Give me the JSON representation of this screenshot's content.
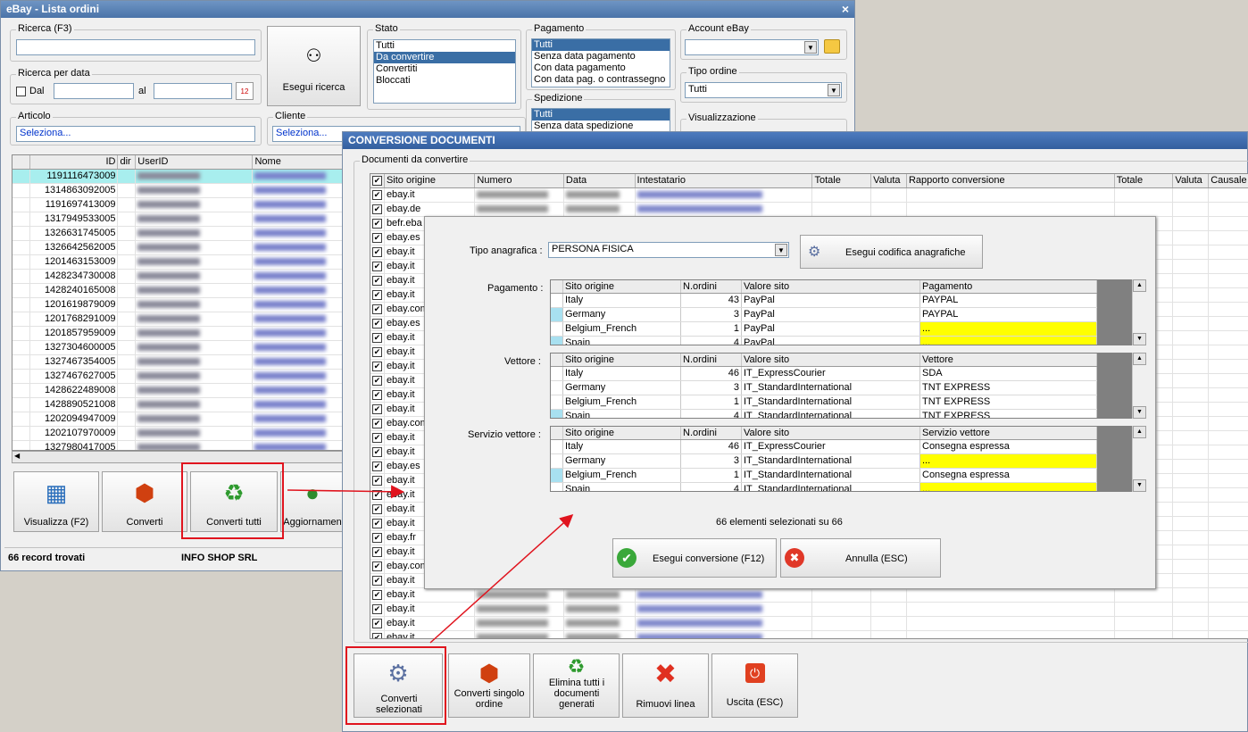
{
  "main_window": {
    "title": "eBay - Lista ordini",
    "close": "×",
    "ricerca_label": "Ricerca (F3)",
    "ricerca_value": "",
    "ricerca_data_label": "Ricerca per data",
    "dal_label": "Dal",
    "al_label": "al",
    "calendar_text": "12",
    "esegui_ricerca": "Esegui ricerca",
    "articolo_label": "Articolo",
    "articolo_value": "Seleziona...",
    "cliente_label": "Cliente",
    "cliente_value": "Seleziona...",
    "stato_label": "Stato",
    "stato_items": [
      "Tutti",
      "Da convertire",
      "Convertiti",
      "Bloccati"
    ],
    "pagamento_label": "Pagamento",
    "pagamento_items": [
      "Tutti",
      "Senza data pagamento",
      "Con data pagamento",
      "Con data pag. o contrassegno"
    ],
    "spedizione_label": "Spedizione",
    "spedizione_items": [
      "Tutti",
      "Senza data spedizione"
    ],
    "account_label": "Account eBay",
    "account_value": "",
    "tipo_ordine_label": "Tipo ordine",
    "tipo_ordine_value": "Tutti",
    "visualizzazione_label": "Visualizzazione",
    "grid_headers": [
      "ID",
      "dir",
      "UserID",
      "Nome"
    ],
    "grid_ids": [
      "1191116473009",
      "1314863092005",
      "1191697413009",
      "1317949533005",
      "1326631745005",
      "1326642562005",
      "1201463153009",
      "1428234730008",
      "1428240165008",
      "1201619879009",
      "1201768291009",
      "1201857959009",
      "1327304600005",
      "1327467354005",
      "1327467627005",
      "1428622489008",
      "1428890521008",
      "1202094947009",
      "1202107970009",
      "1327980417005"
    ],
    "btn_visualizza": "Visualizza (F2)",
    "btn_converti": "Converti",
    "btn_converti_tutti": "Converti tutti",
    "btn_aggiornamenti": "Aggiornamen",
    "status_records": "66 record trovati",
    "status_company": "INFO SHOP SRL"
  },
  "conv_window": {
    "title": "CONVERSIONE DOCUMENTI",
    "group_label": "Documenti da convertire",
    "headers": [
      "Sito origine",
      "Numero",
      "Data",
      "Intestatario",
      "Totale",
      "Valuta",
      "Rapporto conversione",
      "Totale",
      "Valuta",
      "Causale"
    ],
    "sites": [
      "ebay.it",
      "ebay.de",
      "befr.eba",
      "ebay.es",
      "ebay.it",
      "ebay.it",
      "ebay.it",
      "ebay.it",
      "ebay.com",
      "ebay.es",
      "ebay.it",
      "ebay.it",
      "ebay.it",
      "ebay.it",
      "ebay.it",
      "ebay.it",
      "ebay.com",
      "ebay.it",
      "ebay.it",
      "ebay.es",
      "ebay.it",
      "ebay.it",
      "ebay.it",
      "ebay.it",
      "ebay.fr",
      "ebay.it",
      "ebay.com",
      "ebay.it",
      "ebay.it",
      "ebay.it",
      "ebay.it",
      "ebay.it"
    ],
    "btn_converti_selezionati": "Converti selezionati",
    "btn_converti_singolo": "Converti singolo ordine",
    "btn_elimina": "Elimina tutti i documenti generati",
    "btn_rimuovi": "Rimuovi linea",
    "btn_uscita": "Uscita (ESC)"
  },
  "dialog": {
    "tipo_anagrafica_label": "Tipo anagrafica :",
    "tipo_anagrafica_value": "PERSONA FISICA",
    "btn_codifica": "Esegui codifica anagrafiche",
    "pagamento_label": "Pagamento :",
    "vettore_label": "Vettore :",
    "servizio_label": "Servizio vettore :",
    "col_sito": "Sito origine",
    "col_nordini": "N.ordini",
    "col_valore": "Valore sito",
    "col_pagamento": "Pagamento",
    "col_vettore": "Vettore",
    "col_servizio": "Servizio vettore",
    "pagamento_rows": [
      {
        "sito": "Italy",
        "n": "43",
        "valore": "PayPal",
        "target": "PAYPAL",
        "yellow": false
      },
      {
        "sito": "Germany",
        "n": "3",
        "valore": "PayPal",
        "target": "PAYPAL",
        "yellow": false
      },
      {
        "sito": "Belgium_French",
        "n": "1",
        "valore": "PayPal",
        "target": "...",
        "yellow": true
      },
      {
        "sito": "Spain",
        "n": "4",
        "valore": "PayPal",
        "target": "...",
        "yellow": true
      }
    ],
    "vettore_rows": [
      {
        "sito": "Italy",
        "n": "46",
        "valore": "IT_ExpressCourier",
        "target": "SDA",
        "yellow": false
      },
      {
        "sito": "Germany",
        "n": "3",
        "valore": "IT_StandardInternational",
        "target": "TNT EXPRESS",
        "yellow": false
      },
      {
        "sito": "Belgium_French",
        "n": "1",
        "valore": "IT_StandardInternational",
        "target": "TNT EXPRESS",
        "yellow": false
      },
      {
        "sito": "Spain",
        "n": "4",
        "valore": "IT_StandardInternational",
        "target": "TNT EXPRESS",
        "yellow": false
      }
    ],
    "servizio_rows": [
      {
        "sito": "Italy",
        "n": "46",
        "valore": "IT_ExpressCourier",
        "target": "Consegna espressa",
        "yellow": false
      },
      {
        "sito": "Germany",
        "n": "3",
        "valore": "IT_StandardInternational",
        "target": "...",
        "yellow": true
      },
      {
        "sito": "Belgium_French",
        "n": "1",
        "valore": "IT_StandardInternational",
        "target": "Consegna espressa",
        "yellow": false
      },
      {
        "sito": "Spain",
        "n": "4",
        "valore": "IT_StandardInternational",
        "target": "...",
        "yellow": true
      }
    ],
    "selected_text": "66 elementi selezionati su 66",
    "btn_esegui": "Esegui conversione (F12)",
    "btn_annulla": "Annulla (ESC)"
  }
}
